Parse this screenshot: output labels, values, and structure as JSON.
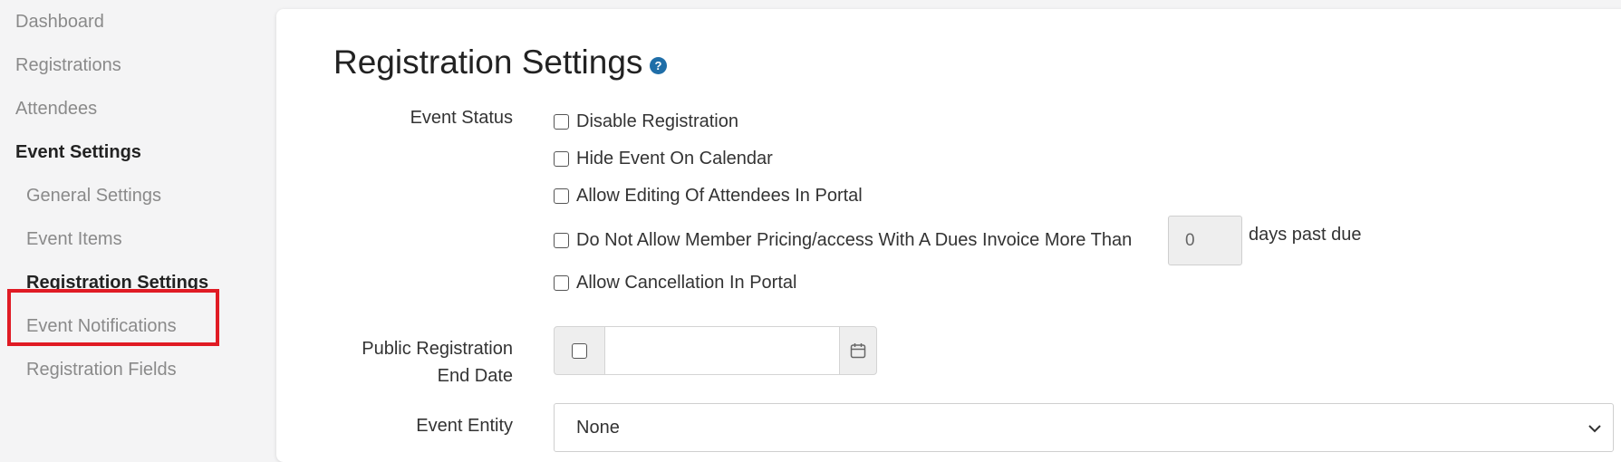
{
  "sidebar": {
    "items": [
      {
        "label": "Dashboard"
      },
      {
        "label": "Registrations"
      },
      {
        "label": "Attendees"
      },
      {
        "label": "Event Settings"
      },
      {
        "label": "General Settings"
      },
      {
        "label": "Event Items"
      },
      {
        "label": "Registration Settings"
      },
      {
        "label": "Event Notifications"
      },
      {
        "label": "Registration Fields"
      }
    ],
    "active_item": "Registration Settings",
    "highlight_color": "#e01b24"
  },
  "main": {
    "title": "Registration Settings",
    "help_icon": "question-circle-icon",
    "help_glyph": "?",
    "accent_color": "#1f6ea8",
    "event_status": {
      "label": "Event Status",
      "options": [
        {
          "label": "Disable Registration",
          "checked": false
        },
        {
          "label": "Hide Event On Calendar",
          "checked": false
        },
        {
          "label": "Allow Editing Of Attendees In Portal",
          "checked": false
        },
        {
          "label": "Do Not Allow Member Pricing/access With A Dues Invoice More Than",
          "checked": false
        },
        {
          "label": "Allow Cancellation In Portal",
          "checked": false
        }
      ],
      "days_value": "0",
      "days_suffix": "days past due"
    },
    "public_end_date": {
      "label_line1": "Public Registration",
      "label_line2": "End Date",
      "enabled": false,
      "value": "",
      "calendar_icon": "calendar-icon"
    },
    "event_entity": {
      "label": "Event Entity",
      "value": "None",
      "dropdown_icon": "chevron-down-icon"
    }
  }
}
